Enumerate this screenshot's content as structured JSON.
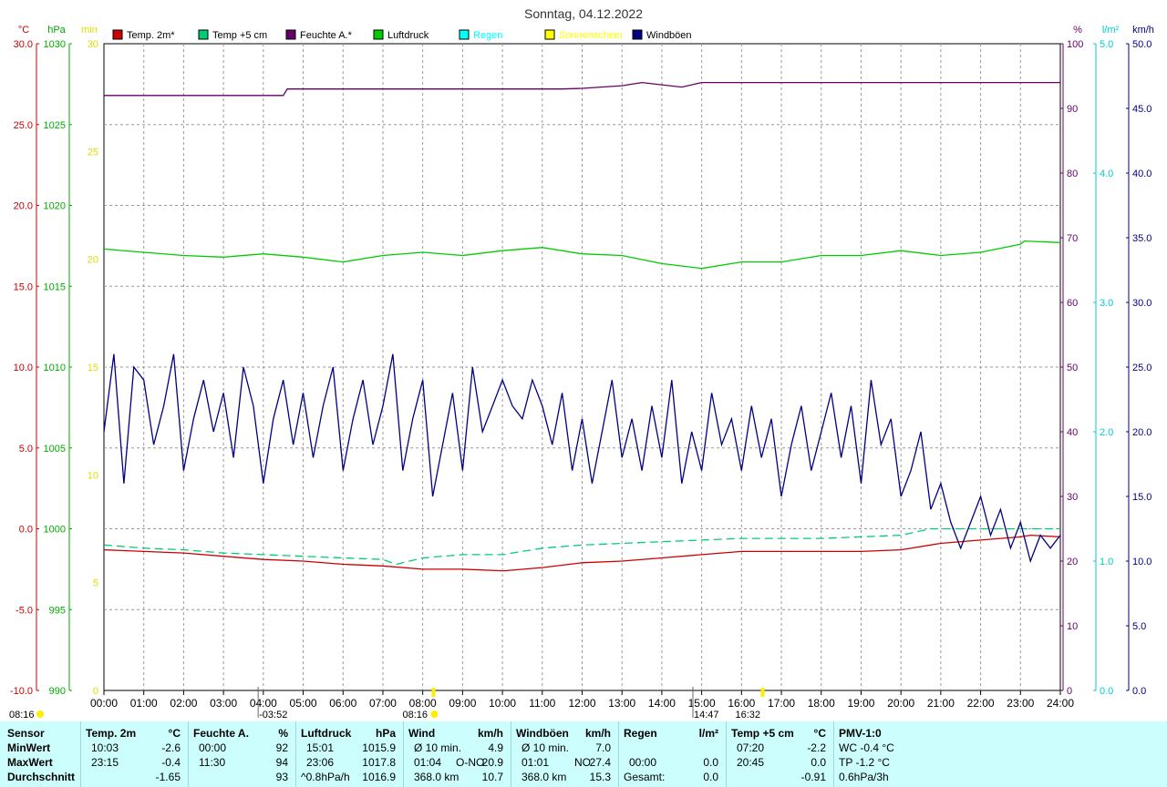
{
  "chart_data": {
    "type": "line",
    "title": "Sonntag, 04.12.2022",
    "x_ticks": [
      "00:00",
      "01:00",
      "02:00",
      "03:00",
      "04:00",
      "05:00",
      "06:00",
      "07:00",
      "08:00",
      "09:00",
      "10:00",
      "11:00",
      "12:00",
      "13:00",
      "14:00",
      "15:00",
      "16:00",
      "17:00",
      "18:00",
      "19:00",
      "20:00",
      "21:00",
      "22:00",
      "23:00",
      "24:00"
    ],
    "x_range_hours": [
      0,
      24
    ],
    "grid": true,
    "legend_position": "top",
    "axes": {
      "temp_c": {
        "unit": "°C",
        "color": "#cc0000",
        "range": [
          -10,
          30
        ],
        "ticks": [
          "-10.0",
          "-5.0",
          "0.0",
          "5.0",
          "10.0",
          "15.0",
          "20.0",
          "25.0",
          "30.0"
        ]
      },
      "press_hpa": {
        "unit": "hPa",
        "color": "#00aa00",
        "range": [
          990,
          1030
        ],
        "ticks": [
          "990",
          "995",
          "1000",
          "1005",
          "1010",
          "1015",
          "1020",
          "1025",
          "1030"
        ]
      },
      "sun_min": {
        "unit": "min",
        "color": "#dddd00",
        "range": [
          0,
          30
        ],
        "ticks": [
          "0",
          "5",
          "10",
          "15",
          "20",
          "25",
          "30"
        ]
      },
      "hum_pct": {
        "unit": "%",
        "color": "#660066",
        "range": [
          0,
          100
        ],
        "ticks": [
          "0",
          "10",
          "20",
          "30",
          "40",
          "50",
          "60",
          "70",
          "80",
          "90",
          "100"
        ]
      },
      "rain_lm2": {
        "unit": "l/m²",
        "color": "#00cccc",
        "range": [
          0,
          5
        ],
        "ticks": [
          "0.0",
          "1.0",
          "2.0",
          "3.0",
          "4.0",
          "5.0"
        ]
      },
      "wind_kmh": {
        "unit": "km/h",
        "color": "#000080",
        "range": [
          0,
          50
        ],
        "ticks": [
          "0.0",
          "5.0",
          "10.0",
          "15.0",
          "20.0",
          "25.0",
          "30.0",
          "35.0",
          "40.0",
          "45.0",
          "50.0"
        ]
      }
    },
    "series": [
      {
        "name": "Temp. 2m*",
        "color": "#cc0000",
        "axis": "temp_c",
        "x": [
          0,
          1,
          2,
          3,
          4,
          5,
          6,
          7,
          8,
          9,
          10,
          10.05,
          11,
          12,
          13,
          14,
          15,
          16,
          17,
          18,
          19,
          20,
          21,
          22,
          23,
          23.25,
          24
        ],
        "y": [
          -1.3,
          -1.4,
          -1.5,
          -1.7,
          -1.9,
          -2.0,
          -2.2,
          -2.3,
          -2.5,
          -2.5,
          -2.6,
          -2.6,
          -2.4,
          -2.1,
          -2.0,
          -1.8,
          -1.6,
          -1.4,
          -1.4,
          -1.4,
          -1.4,
          -1.3,
          -0.9,
          -0.7,
          -0.5,
          -0.4,
          -0.5
        ]
      },
      {
        "name": "Temp +5 cm",
        "color": "#00cc77",
        "axis": "temp_c",
        "dashed": true,
        "x": [
          0,
          1,
          2,
          3,
          4,
          5,
          6,
          7,
          7.33,
          8,
          9,
          10,
          11,
          12,
          13,
          14,
          15,
          16,
          17,
          18,
          19,
          20,
          20.75,
          21,
          22,
          23,
          24
        ],
        "y": [
          -1.0,
          -1.2,
          -1.3,
          -1.5,
          -1.6,
          -1.7,
          -1.8,
          -1.9,
          -2.2,
          -1.8,
          -1.6,
          -1.6,
          -1.2,
          -1.0,
          -0.9,
          -0.8,
          -0.7,
          -0.6,
          -0.6,
          -0.6,
          -0.5,
          -0.4,
          0.0,
          0.0,
          0.0,
          0.0,
          0.0
        ]
      },
      {
        "name": "Feuchte A.*",
        "color": "#660066",
        "axis": "hum_pct",
        "x": [
          0,
          4.5,
          4.6,
          11.5,
          12,
          13,
          13.5,
          14.5,
          15,
          16,
          17,
          18,
          24
        ],
        "y": [
          92,
          92,
          93,
          93,
          93.1,
          93.5,
          94,
          93.3,
          94,
          94,
          94,
          94,
          94
        ]
      },
      {
        "name": "Luftdruck",
        "color": "#00cc00",
        "axis": "press_hpa",
        "x": [
          0,
          1,
          2,
          3,
          4,
          5,
          6,
          7,
          8,
          9,
          10,
          11,
          12,
          13,
          14,
          15,
          16,
          17,
          18,
          19,
          20,
          21,
          22,
          23,
          23.1,
          24
        ],
        "y": [
          1017.3,
          1017.1,
          1016.9,
          1016.8,
          1017.0,
          1016.8,
          1016.5,
          1016.9,
          1017.1,
          1016.9,
          1017.2,
          1017.4,
          1017.0,
          1016.9,
          1016.4,
          1016.1,
          1016.5,
          1016.5,
          1016.9,
          1016.9,
          1017.2,
          1016.9,
          1017.1,
          1017.6,
          1017.8,
          1017.7
        ]
      },
      {
        "name": "Regen",
        "color": "#00ffff",
        "axis": "rain_lm2",
        "x": [],
        "y": []
      },
      {
        "name": "Sonnenschein",
        "color": "#ffff00",
        "axis": "sun_min",
        "x": [],
        "y": []
      },
      {
        "name": "Windböen",
        "color": "#000080",
        "axis": "wind_kmh",
        "x": [
          0,
          0.25,
          0.5,
          0.75,
          1,
          1.25,
          1.5,
          1.75,
          2,
          2.25,
          2.5,
          2.75,
          3,
          3.25,
          3.5,
          3.75,
          4,
          4.25,
          4.5,
          4.75,
          5,
          5.25,
          5.5,
          5.75,
          6,
          6.25,
          6.5,
          6.75,
          7,
          7.25,
          7.5,
          7.75,
          8,
          8.25,
          8.5,
          8.75,
          9,
          9.25,
          9.5,
          9.75,
          10,
          10.25,
          10.5,
          10.75,
          11,
          11.25,
          11.5,
          11.75,
          12,
          12.25,
          12.5,
          12.75,
          13,
          13.25,
          13.5,
          13.75,
          14,
          14.25,
          14.5,
          14.75,
          15,
          15.25,
          15.5,
          15.75,
          16,
          16.25,
          16.5,
          16.75,
          17,
          17.25,
          17.5,
          17.75,
          18,
          18.25,
          18.5,
          18.75,
          19,
          19.25,
          19.5,
          19.75,
          20,
          20.25,
          20.5,
          20.75,
          21,
          21.25,
          21.5,
          21.75,
          22,
          22.25,
          22.5,
          22.75,
          23,
          23.25,
          23.5,
          23.75,
          24
        ],
        "y": [
          20,
          26,
          16,
          25,
          24,
          19,
          22,
          26,
          17,
          21,
          24,
          20,
          23,
          18,
          25,
          22,
          16,
          21,
          24,
          19,
          23,
          18,
          22,
          25,
          17,
          21,
          24,
          19,
          22,
          26,
          17,
          21,
          24,
          15,
          19,
          23,
          17,
          25,
          20,
          22,
          24,
          22,
          21,
          24,
          22,
          19,
          23,
          17,
          21,
          16,
          20,
          24,
          18,
          21,
          17,
          22,
          18,
          24,
          16,
          20,
          17,
          23,
          19,
          21,
          17,
          22,
          18,
          21,
          15,
          19,
          22,
          17,
          20,
          23,
          18,
          22,
          16,
          24,
          19,
          21,
          15,
          17,
          20,
          14,
          16,
          13,
          11,
          13,
          15,
          12,
          14,
          11,
          13,
          10,
          12,
          11,
          12
        ]
      }
    ],
    "sunrise_label": "08:16",
    "sunset_label": "16:32",
    "left_marker_label": "08:16",
    "markers": [
      {
        "hour": 3.87,
        "label": "-03:52"
      },
      {
        "hour": 14.78,
        "label": "14:47"
      }
    ],
    "sun_dots": [
      8.27,
      16.53
    ]
  },
  "stats": {
    "row_labels": [
      "Sensor",
      "MinWert",
      "MaxWert",
      "Durchschnitt"
    ],
    "temp2m": {
      "title": "Temp. 2m",
      "unit": "°C",
      "min_time": "10:03",
      "min": "-2.6",
      "max_time": "23:15",
      "max": "-0.4",
      "avg": "-1.65"
    },
    "humidity": {
      "title": "Feuchte A.",
      "unit": "%",
      "min_time": "00:00",
      "min": "92",
      "max_time": "11:30",
      "max": "94",
      "avg": "93"
    },
    "pressure": {
      "title": "Luftdruck",
      "unit": "hPa",
      "min_time": "15:01",
      "min": "1015.9",
      "max_time": "23:06",
      "max": "1017.8",
      "trend": "^0.8hPa/h",
      "avg": "1016.9"
    },
    "wind": {
      "title": "Wind",
      "unit": "km/h",
      "r1_label": "Ø 10 min.",
      "r1_val": "4.9",
      "r2_time": "01:04",
      "r2_dir": "O-NO",
      "r2_val": "20.9",
      "r3_dist": "368.0 km",
      "r3_val": "10.7"
    },
    "gusts": {
      "title": "Windböen",
      "unit": "km/h",
      "r1_label": "Ø 10 min.",
      "r1_val": "7.0",
      "r2_time": "01:01",
      "r2_dir": "NO",
      "r2_val": "27.4",
      "r3_dist": "368.0 km",
      "r3_val": "15.3"
    },
    "rain": {
      "title": "Regen",
      "unit": "l/m²",
      "r2_time": "00:00",
      "r2_val": "0.0",
      "r3_label": "Gesamt:",
      "r3_val": "0.0"
    },
    "temp5cm": {
      "title": "Temp +5 cm",
      "unit": "°C",
      "min_time": "07:20",
      "min": "-2.2",
      "max_time": "20:45",
      "max": "0.0",
      "avg": "-0.91"
    },
    "pmv": {
      "title": "PMV-1:0",
      "r1": "WC -0.4 °C",
      "r2": "TP -1.2 °C",
      "r3": "0.6hPa/3h"
    }
  }
}
